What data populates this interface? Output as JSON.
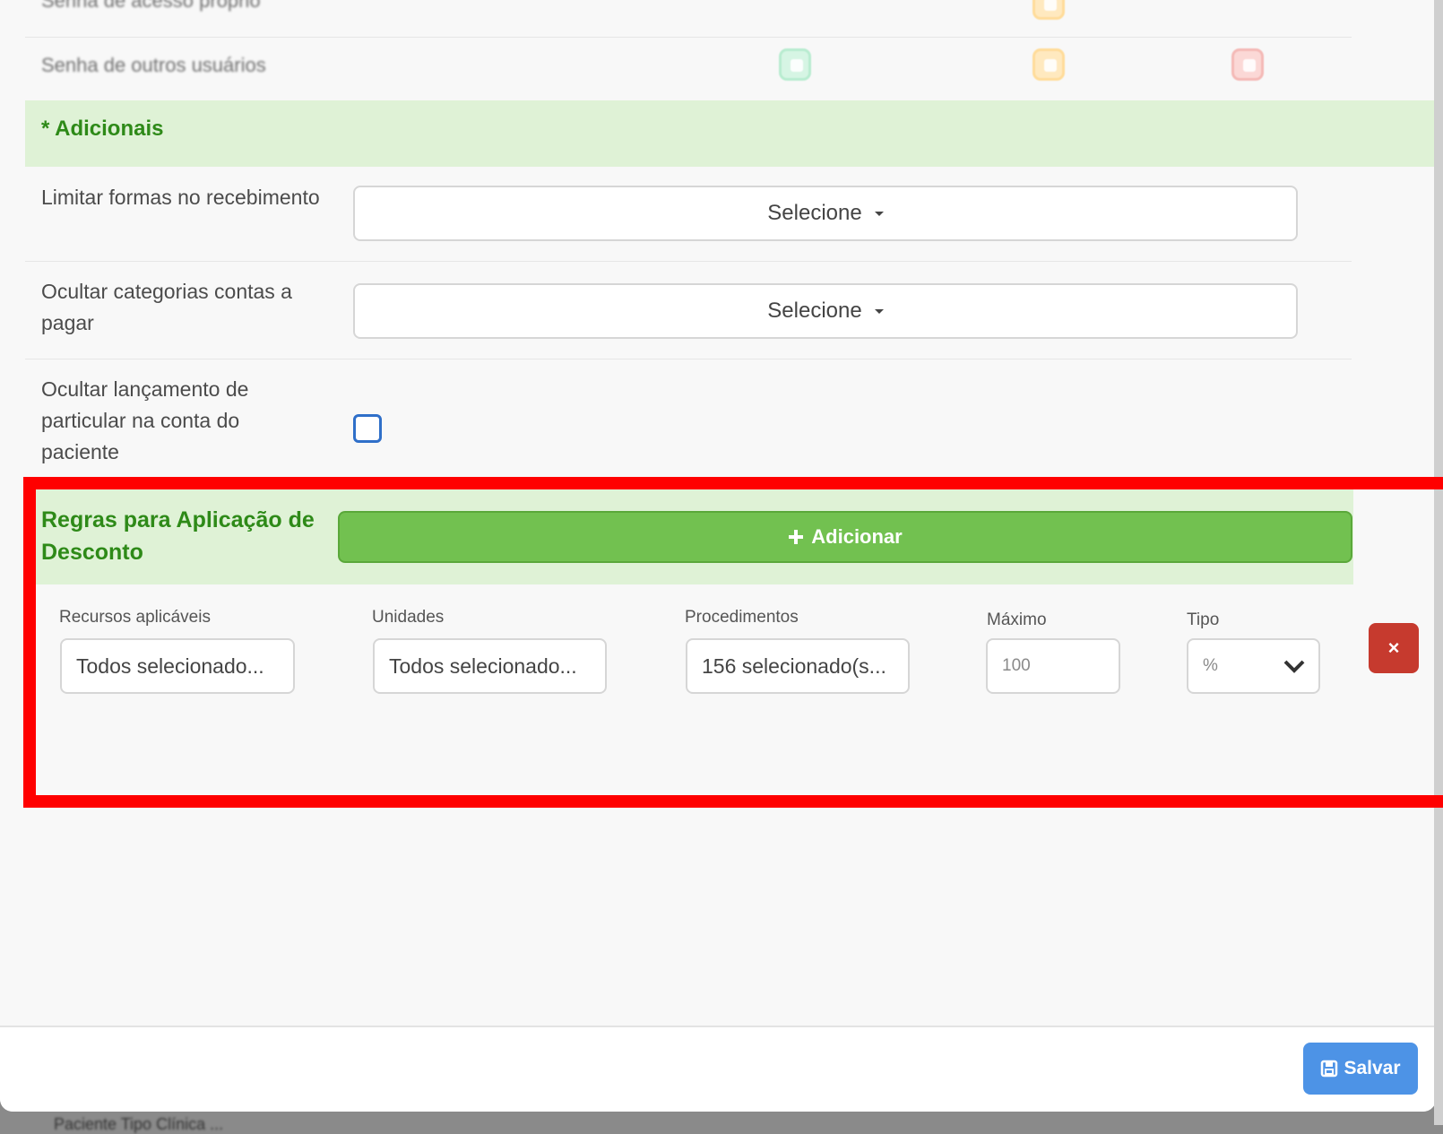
{
  "permissions": {
    "rows": [
      {
        "label": "Senha de acesso próprio"
      },
      {
        "label": "Senha de outros usuários"
      }
    ]
  },
  "additional": {
    "title": "* Adicionais",
    "limit_payment_methods": {
      "label": "Limitar formas no recebimento",
      "value": "Selecione"
    },
    "hide_payable_categories": {
      "label": "Ocultar categorias contas a pagar",
      "value": "Selecione"
    },
    "hide_private_entry": {
      "label": "Ocultar lançamento de particular na conta do paciente",
      "checked": false
    }
  },
  "discount_rules": {
    "title": "Regras para Aplicação de Desconto",
    "add_label": "Adicionar",
    "fields": {
      "resources": {
        "label": "Recursos aplicáveis",
        "value": "Todos selecionado..."
      },
      "units": {
        "label": "Unidades",
        "value": "Todos selecionado..."
      },
      "procedures": {
        "label": "Procedimentos",
        "value": "156 selecionado(s..."
      },
      "maximum": {
        "label": "Máximo",
        "placeholder": "100"
      },
      "type": {
        "label": "Tipo",
        "value": "%"
      }
    },
    "remove_label": "×"
  },
  "footer": {
    "save_label": "Salvar"
  },
  "background": {
    "text": "Paciente Tipo Clínica ..."
  }
}
